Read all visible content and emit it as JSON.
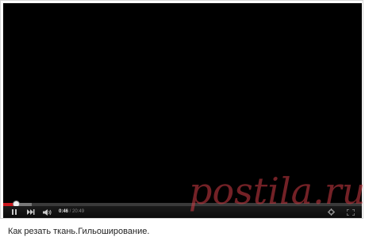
{
  "player": {
    "current_time": "0:46",
    "separator": " / ",
    "duration": "20:49",
    "played_fraction": 0.037,
    "loaded_fraction": 0.08,
    "state": "playing",
    "controls": {
      "pause_icon": "pause-icon",
      "next_icon": "next-icon",
      "volume_icon": "volume-icon",
      "settings_icon": "gear-icon",
      "fullscreen_icon": "fullscreen-icon"
    },
    "colors": {
      "progress_played": "#cc181e",
      "background": "#000000"
    }
  },
  "watermark": {
    "text": "postila.ru"
  },
  "caption": {
    "title": "Как резать ткань.Гильоширование."
  }
}
